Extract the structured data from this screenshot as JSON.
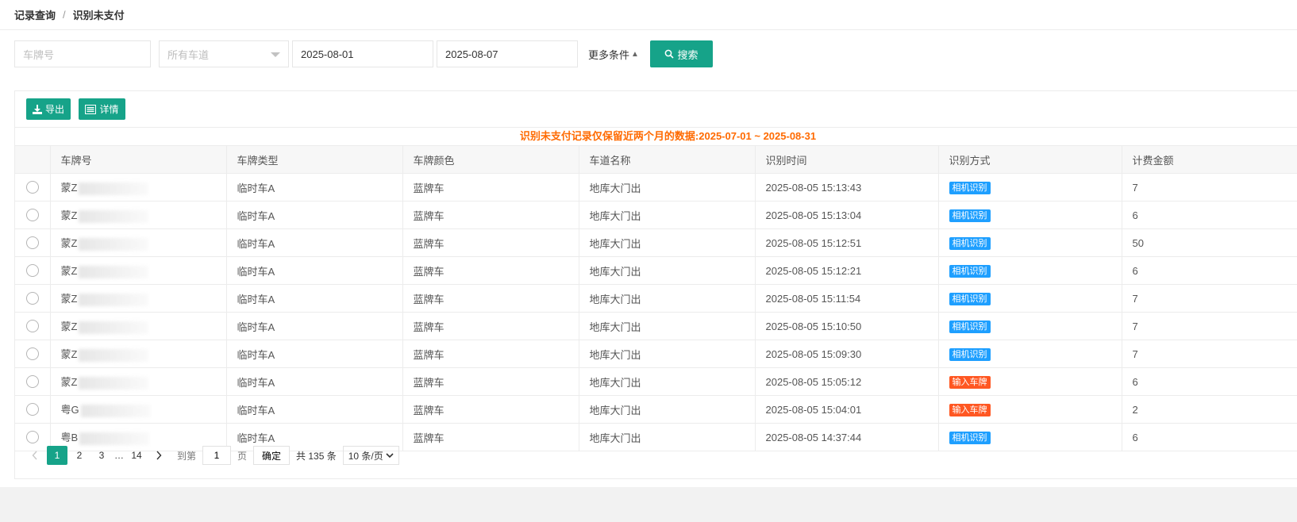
{
  "breadcrumb": {
    "parent": "记录查询",
    "separator": "/",
    "current": "识别未支付"
  },
  "filters": {
    "plate_placeholder": "车牌号",
    "lane_placeholder": "所有车道",
    "start_date": "2025-08-01",
    "end_date": "2025-08-07",
    "more_label": "更多条件",
    "more_icon": "▲",
    "search_label": "搜索"
  },
  "toolbar": {
    "export_label": "导出",
    "detail_label": "详情"
  },
  "notice": {
    "text": "识别未支付记录仅保留近两个月的数据:",
    "range": "2025-07-01 ~ 2025-08-31"
  },
  "table": {
    "columns": [
      "车牌号",
      "车牌类型",
      "车牌颜色",
      "车道名称",
      "识别时间",
      "识别方式",
      "计费金额"
    ],
    "rows": [
      {
        "plate": "蒙Z",
        "type": "临时车A",
        "color": "蓝牌车",
        "lane": "地库大门出",
        "time": "2025-08-05 15:13:43",
        "method": "相机识别",
        "method_kind": "cam",
        "amount": "7"
      },
      {
        "plate": "蒙Z",
        "type": "临时车A",
        "color": "蓝牌车",
        "lane": "地库大门出",
        "time": "2025-08-05 15:13:04",
        "method": "相机识别",
        "method_kind": "cam",
        "amount": "6"
      },
      {
        "plate": "蒙Z",
        "type": "临时车A",
        "color": "蓝牌车",
        "lane": "地库大门出",
        "time": "2025-08-05 15:12:51",
        "method": "相机识别",
        "method_kind": "cam",
        "amount": "50"
      },
      {
        "plate": "蒙Z",
        "type": "临时车A",
        "color": "蓝牌车",
        "lane": "地库大门出",
        "time": "2025-08-05 15:12:21",
        "method": "相机识别",
        "method_kind": "cam",
        "amount": "6"
      },
      {
        "plate": "蒙Z",
        "type": "临时车A",
        "color": "蓝牌车",
        "lane": "地库大门出",
        "time": "2025-08-05 15:11:54",
        "method": "相机识别",
        "method_kind": "cam",
        "amount": "7"
      },
      {
        "plate": "蒙Z",
        "type": "临时车A",
        "color": "蓝牌车",
        "lane": "地库大门出",
        "time": "2025-08-05 15:10:50",
        "method": "相机识别",
        "method_kind": "cam",
        "amount": "7"
      },
      {
        "plate": "蒙Z",
        "type": "临时车A",
        "color": "蓝牌车",
        "lane": "地库大门出",
        "time": "2025-08-05 15:09:30",
        "method": "相机识别",
        "method_kind": "cam",
        "amount": "7"
      },
      {
        "plate": "蒙Z",
        "type": "临时车A",
        "color": "蓝牌车",
        "lane": "地库大门出",
        "time": "2025-08-05 15:05:12",
        "method": "输入车牌",
        "method_kind": "inp",
        "amount": "6"
      },
      {
        "plate": "粤G",
        "type": "临时车A",
        "color": "蓝牌车",
        "lane": "地库大门出",
        "time": "2025-08-05 15:04:01",
        "method": "输入车牌",
        "method_kind": "inp",
        "amount": "2"
      },
      {
        "plate": "粤B",
        "type": "临时车A",
        "color": "蓝牌车",
        "lane": "地库大门出",
        "time": "2025-08-05 14:37:44",
        "method": "相机识别",
        "method_kind": "cam",
        "amount": "6"
      }
    ]
  },
  "pagination": {
    "pages": [
      "1",
      "2",
      "3"
    ],
    "ellipsis": "…",
    "last_page": "14",
    "goto_label": "到第",
    "goto_value": "1",
    "page_unit": "页",
    "confirm_label": "确定",
    "total_label": "共 135 条",
    "page_size": "10 条/页"
  },
  "colors": {
    "primary": "#16a389",
    "camera_tag": "#1e9fff",
    "input_tag": "#ff5722",
    "notice": "#ff6a00"
  }
}
